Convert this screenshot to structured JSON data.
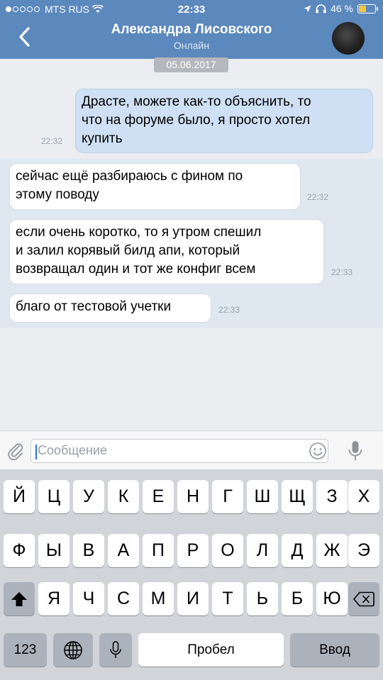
{
  "status_bar": {
    "carrier": "MTS RUS",
    "time": "22:33",
    "battery": "46 %",
    "battery_level": 0.46
  },
  "header": {
    "contact_name": "Александра Лисовского",
    "contact_status": "Онлайн",
    "accent_color": "#5b88bd"
  },
  "date_badge": "05.06.2017",
  "messages": [
    {
      "direction": "out",
      "lines": [
        "Драсте, можете как-то объяснить, то",
        "что на форуме было, я просто хотел",
        "купить"
      ],
      "time": "22:32"
    },
    {
      "direction": "in",
      "lines": [
        "сейчас ещё разбираюсь с фином по",
        "этому поводу"
      ],
      "time": "22:32"
    },
    {
      "direction": "in",
      "lines": [
        "если очень коротко, то я утром спешил",
        "и залил корявый билд апи, который",
        "возвращал один и тот же конфиг всем"
      ],
      "time": "22:33"
    },
    {
      "direction": "in",
      "lines": [
        "благо от тестовой учетки"
      ],
      "time": "22:33"
    }
  ],
  "composer": {
    "placeholder": "Сообщение"
  },
  "keyboard": {
    "row1": [
      "Й",
      "Ц",
      "У",
      "К",
      "Е",
      "Н",
      "Г",
      "Ш",
      "Щ",
      "З",
      "Х"
    ],
    "row2": [
      "Ф",
      "Ы",
      "В",
      "А",
      "П",
      "Р",
      "О",
      "Л",
      "Д",
      "Ж",
      "Э"
    ],
    "row3": [
      "Я",
      "Ч",
      "С",
      "М",
      "И",
      "Т",
      "Ь",
      "Б",
      "Ю"
    ],
    "numbers_key": "123",
    "space_key": "Пробел",
    "return_key": "Ввод"
  }
}
